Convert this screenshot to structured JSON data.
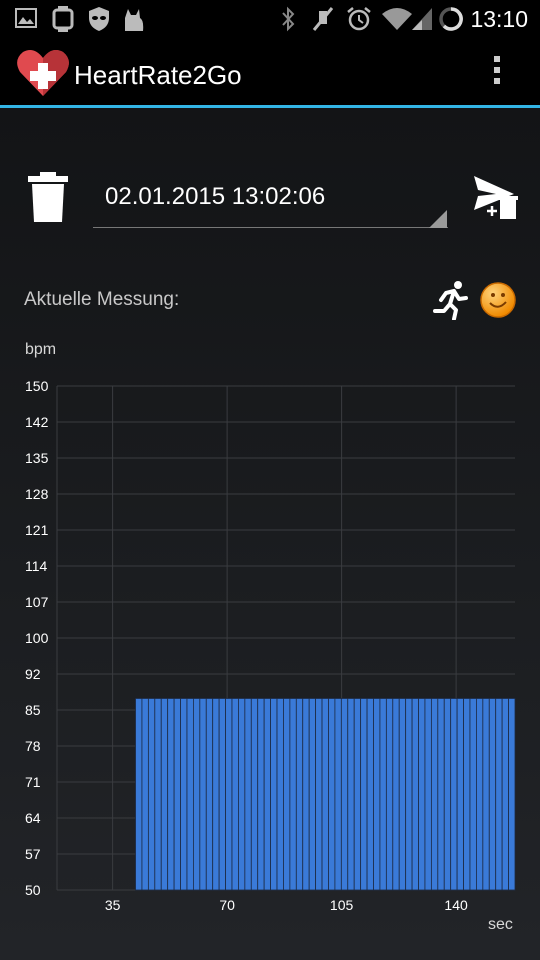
{
  "status_bar": {
    "time": "13:10",
    "left_icons": [
      "image-icon",
      "watch-icon",
      "privacy-mask-icon",
      "cat-icon"
    ],
    "right_icons": [
      "bluetooth-icon",
      "mute-icon",
      "alarm-icon",
      "wifi-icon",
      "signal-icon",
      "battery-icon"
    ]
  },
  "action_bar": {
    "app_name": "HeartRate2Go",
    "logo_icon": "heart-plus-icon",
    "menu_icon": "overflow-menu-icon",
    "accent": "#33b5e5"
  },
  "measurement_selector": {
    "selected": "02.01.2015 13:02:06",
    "delete_icon": "trash-icon",
    "send_icon": "send-icon"
  },
  "current_label": "Aktuelle Messung:",
  "indicators": {
    "activity_icon": "running-person-icon",
    "mood_icon": "smiley-icon"
  },
  "chart_data": {
    "type": "bar",
    "ylabel": "bpm",
    "xlabel": "sec",
    "yticks": [
      "150",
      "142",
      "135",
      "128",
      "121",
      "114",
      "107",
      "100",
      "92",
      "85",
      "78",
      "71",
      "64",
      "57",
      "50"
    ],
    "xticks": [
      "35",
      "70",
      "105",
      "140"
    ],
    "ylim": [
      50,
      150
    ],
    "xlim": [
      18,
      158
    ],
    "x_start": 42,
    "x_end": 158,
    "bar_count": 59,
    "values": [
      88,
      88,
      88,
      88,
      88,
      88,
      88,
      88,
      88,
      88,
      88,
      88,
      88,
      88,
      88,
      88,
      88,
      88,
      88,
      88,
      88,
      88,
      88,
      88,
      88,
      88,
      88,
      88,
      88,
      88,
      88,
      88,
      88,
      88,
      88,
      88,
      88,
      88,
      88,
      88,
      88,
      88,
      88,
      88,
      88,
      88,
      88,
      88,
      88,
      88,
      88,
      88,
      88,
      88,
      88,
      88,
      88,
      88,
      88
    ],
    "bar_color": "#3a7ad8",
    "grid": true
  }
}
